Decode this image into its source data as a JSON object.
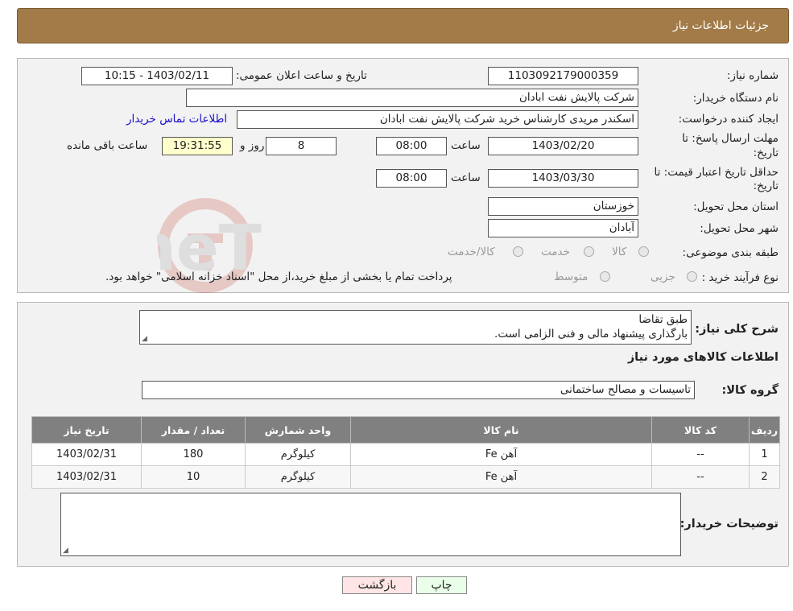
{
  "header": {
    "title": "جزئیات اطلاعات نیاز"
  },
  "labels": {
    "need_number": "شماره نیاز:",
    "announce_datetime": "تاریخ و ساعت اعلان عمومی:",
    "buyer_org": "نام دستگاه خریدار:",
    "creator": "ایجاد کننده درخواست:",
    "reply_deadline_1": "مهلت ارسال پاسخ: تا",
    "reply_deadline_2": "تاریخ:",
    "price_validity_1": "حداقل تاریخ اعتبار قیمت: تا",
    "price_validity_2": "تاریخ:",
    "province": "استان محل تحویل:",
    "city": "شهر محل تحویل:",
    "category": "طبقه بندی موضوعی:",
    "process": "نوع فرآیند خرید :",
    "hour": "ساعت",
    "day_and": "روز و",
    "remaining": "ساعت باقی مانده",
    "description": "شرح کلی نیاز:",
    "goods_info": "اطلاعات کالاهای مورد نیاز",
    "goods_group": "گروه کالا:",
    "buyer_notes": "توضیحات خریدار:"
  },
  "values": {
    "need_number": "1103092179000359",
    "announce_datetime": "1403/02/11 - 10:15",
    "buyer_org": "شرکت پالایش نفت ابادان",
    "creator": "اسکندر مریدی کارشناس خرید شرکت پالایش نفت ابادان",
    "contact_link": "اطلاعات تماس خریدار",
    "reply_date": "1403/02/20",
    "reply_time": "08:00",
    "days": "8",
    "remaining_time": "19:31:55",
    "validity_date": "1403/03/30",
    "validity_time": "08:00",
    "province": "خوزستان",
    "city": "آبادان",
    "goods_group": "تاسیسات و مصالح ساختمانی"
  },
  "category_options": [
    "کالا",
    "خدمت",
    "کالا/خدمت"
  ],
  "process_options": [
    "جزیی",
    "متوسط"
  ],
  "process_note": "پرداخت تمام یا بخشی از مبلغ خرید،از محل \"اسناد خزانه اسلامی\" خواهد بود.",
  "description": {
    "line1": "طبق تقاضا",
    "line2": "بارگذاری پیشنهاد مالی و فنی الزامی است."
  },
  "table": {
    "headers": [
      "ردیف",
      "کد کالا",
      "نام کالا",
      "واحد شمارش",
      "تعداد / مقدار",
      "تاریخ نیاز"
    ],
    "rows": [
      [
        "1",
        "--",
        "آهن Fe",
        "کیلوگرم",
        "180",
        "1403/02/31"
      ],
      [
        "2",
        "--",
        "آهن Fe",
        "کیلوگرم",
        "10",
        "1403/02/31"
      ]
    ]
  },
  "buttons": {
    "print": "چاپ",
    "back": "بازگشت"
  },
  "watermark": "AriaTender.neT",
  "colors": {
    "header_bg": "#a27b48",
    "table_header_bg": "#808080",
    "print_bg": "#eaffea",
    "back_bg": "#ffe5e5"
  }
}
